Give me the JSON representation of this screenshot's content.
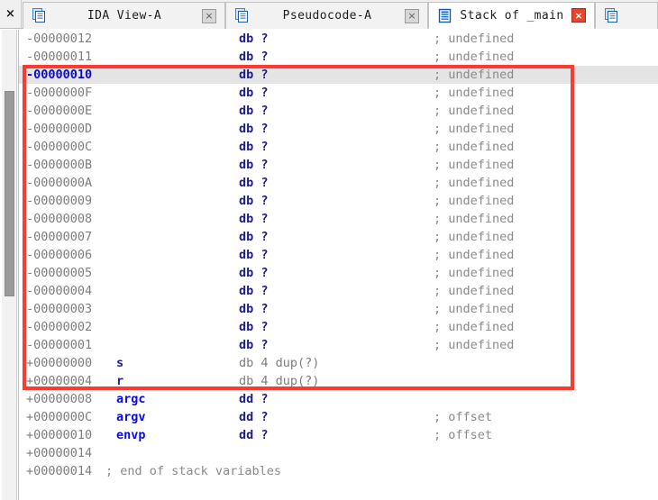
{
  "window": {
    "title": "Stack of _main"
  },
  "tabbar": {
    "close_all_label": "×",
    "tabs": [
      {
        "label": "IDA View-A",
        "icon": "document-icon",
        "active": false,
        "close_label": "×",
        "close_style": "grey"
      },
      {
        "label": "Pseudocode-A",
        "icon": "document-icon",
        "active": false,
        "close_label": "×",
        "close_style": "grey"
      },
      {
        "label": "Stack of _main",
        "icon": "stack-icon",
        "active": true,
        "close_label": "×",
        "close_style": "red"
      },
      {
        "label": "",
        "icon": "document-icon",
        "active": false,
        "close_label": "",
        "close_style": "none"
      }
    ]
  },
  "annotation": {
    "shape": "rectangle",
    "color": "#fb3a33"
  },
  "colors": {
    "address": "#7d7d7d",
    "address_selected": "#0a0ad0",
    "local_var_name": "#1c1c9c",
    "argument_name": "#0a0ae0",
    "directive": "#1c1c8c",
    "comment": "#8a8a8a",
    "selection_background": "#e4e4e4",
    "annotation": "#fb3a33"
  },
  "listing": {
    "selected_address": "-00000010",
    "rows": [
      {
        "addr": "-00000012",
        "name": "",
        "dir": "db ?",
        "dir_style": "blue",
        "cmt": "; undefined",
        "sel": false
      },
      {
        "addr": "-00000011",
        "name": "",
        "dir": "db ?",
        "dir_style": "blue",
        "cmt": "; undefined",
        "sel": false
      },
      {
        "addr": "-00000010",
        "name": "",
        "dir": "db ?",
        "dir_style": "blue",
        "cmt": "; undefined",
        "sel": true
      },
      {
        "addr": "-0000000F",
        "name": "",
        "dir": "db ?",
        "dir_style": "blue",
        "cmt": "; undefined",
        "sel": false
      },
      {
        "addr": "-0000000E",
        "name": "",
        "dir": "db ?",
        "dir_style": "blue",
        "cmt": "; undefined",
        "sel": false
      },
      {
        "addr": "-0000000D",
        "name": "",
        "dir": "db ?",
        "dir_style": "blue",
        "cmt": "; undefined",
        "sel": false
      },
      {
        "addr": "-0000000C",
        "name": "",
        "dir": "db ?",
        "dir_style": "blue",
        "cmt": "; undefined",
        "sel": false
      },
      {
        "addr": "-0000000B",
        "name": "",
        "dir": "db ?",
        "dir_style": "blue",
        "cmt": "; undefined",
        "sel": false
      },
      {
        "addr": "-0000000A",
        "name": "",
        "dir": "db ?",
        "dir_style": "blue",
        "cmt": "; undefined",
        "sel": false
      },
      {
        "addr": "-00000009",
        "name": "",
        "dir": "db ?",
        "dir_style": "blue",
        "cmt": "; undefined",
        "sel": false
      },
      {
        "addr": "-00000008",
        "name": "",
        "dir": "db ?",
        "dir_style": "blue",
        "cmt": "; undefined",
        "sel": false
      },
      {
        "addr": "-00000007",
        "name": "",
        "dir": "db ?",
        "dir_style": "blue",
        "cmt": "; undefined",
        "sel": false
      },
      {
        "addr": "-00000006",
        "name": "",
        "dir": "db ?",
        "dir_style": "blue",
        "cmt": "; undefined",
        "sel": false
      },
      {
        "addr": "-00000005",
        "name": "",
        "dir": "db ?",
        "dir_style": "blue",
        "cmt": "; undefined",
        "sel": false
      },
      {
        "addr": "-00000004",
        "name": "",
        "dir": "db ?",
        "dir_style": "blue",
        "cmt": "; undefined",
        "sel": false
      },
      {
        "addr": "-00000003",
        "name": "",
        "dir": "db ?",
        "dir_style": "blue",
        "cmt": "; undefined",
        "sel": false
      },
      {
        "addr": "-00000002",
        "name": "",
        "dir": "db ?",
        "dir_style": "blue",
        "cmt": "; undefined",
        "sel": false
      },
      {
        "addr": "-00000001",
        "name": "",
        "dir": "db ?",
        "dir_style": "blue",
        "cmt": "; undefined",
        "sel": false
      },
      {
        "addr": "+00000000",
        "name": "s",
        "name_style": "local",
        "dir": "db 4 dup(?)",
        "dir_style": "grey",
        "cmt": "",
        "sel": false
      },
      {
        "addr": "+00000004",
        "name": "r",
        "name_style": "local",
        "dir": "db 4 dup(?)",
        "dir_style": "grey",
        "cmt": "",
        "sel": false
      },
      {
        "addr": "+00000008",
        "name": "argc",
        "name_style": "arg",
        "dir": "dd ?",
        "dir_style": "blue",
        "cmt": "",
        "sel": false
      },
      {
        "addr": "+0000000C",
        "name": "argv",
        "name_style": "arg",
        "dir": "dd ?",
        "dir_style": "blue",
        "cmt": "; offset",
        "sel": false
      },
      {
        "addr": "+00000010",
        "name": "envp",
        "name_style": "arg",
        "dir": "dd ?",
        "dir_style": "blue",
        "cmt": "; offset",
        "sel": false
      },
      {
        "addr": "+00000014",
        "name": "",
        "dir": "",
        "dir_style": "grey",
        "cmt": "",
        "sel": false
      },
      {
        "addr": "+00000014",
        "name": "",
        "dir": "",
        "dir_style": "grey",
        "cmt": "",
        "sel": false,
        "inline_comment": "; end of stack variables"
      }
    ]
  }
}
